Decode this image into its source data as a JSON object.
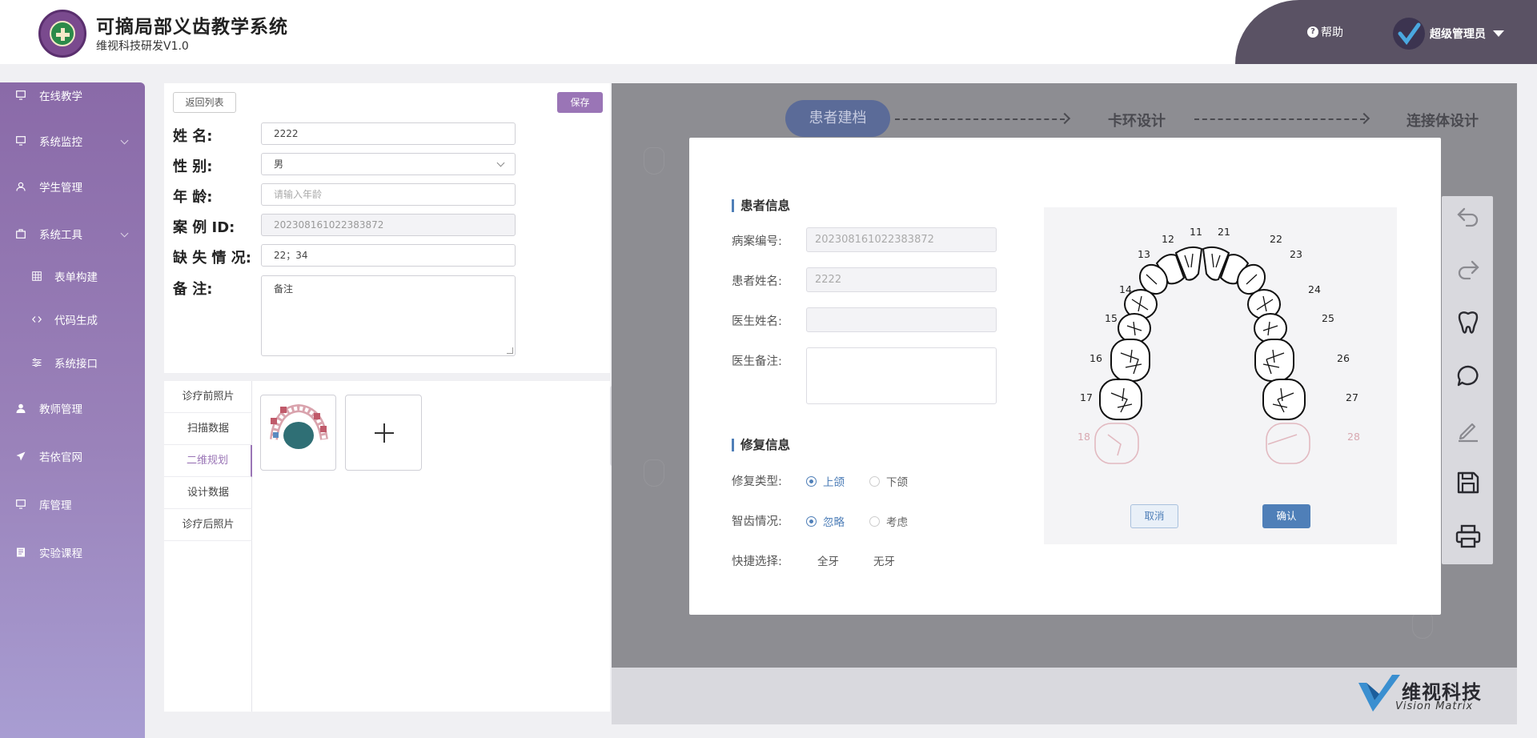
{
  "header": {
    "app_title": "可摘局部义齿教学系统",
    "app_subtitle": "维视科技研发V1.0",
    "help_label": "帮助",
    "user_name": "超级管理员"
  },
  "sidebar": {
    "items": [
      {
        "label": "在线教学",
        "icon": "monitor-icon"
      },
      {
        "label": "系统监控",
        "icon": "monitor-icon"
      },
      {
        "label": "学生管理",
        "icon": "user-icon"
      },
      {
        "label": "系统工具",
        "icon": "toolbox-icon"
      },
      {
        "label": "表单构建",
        "icon": "grid-icon"
      },
      {
        "label": "代码生成",
        "icon": "code-icon"
      },
      {
        "label": "系统接口",
        "icon": "sliders-icon"
      },
      {
        "label": "教师管理",
        "icon": "user-icon"
      },
      {
        "label": "若依官网",
        "icon": "send-icon"
      },
      {
        "label": "库管理",
        "icon": "monitor-icon"
      },
      {
        "label": "实验课程",
        "icon": "book-icon"
      }
    ]
  },
  "form": {
    "back_label": "返回列表",
    "save_label": "保存",
    "name_label": "姓 名:",
    "name_value": "2222",
    "gender_label": "性 别:",
    "gender_value": "男",
    "age_label": "年 龄:",
    "age_placeholder": "请输入年龄",
    "case_id_label": "案 例 ID:",
    "case_id_value": "202308161022383872",
    "missing_label": "缺 失 情 况:",
    "missing_value": "22；34",
    "note_label": "备 注:",
    "note_value": "备注"
  },
  "tabs": [
    {
      "label": "诊疗前照片",
      "active": false
    },
    {
      "label": "扫描数据",
      "active": false
    },
    {
      "label": "二维规划",
      "active": true
    },
    {
      "label": "设计数据",
      "active": false
    },
    {
      "label": "诊疗后照片",
      "active": false
    }
  ],
  "steps": {
    "step1": "患者建档",
    "step2": "卡环设计",
    "step3": "连接体设计"
  },
  "dialog": {
    "patient_section": "患者信息",
    "record_no_label": "病案编号:",
    "record_no_value": "202308161022383872",
    "patient_name_label": "患者姓名:",
    "patient_name_value": "2222",
    "doctor_name_label": "医生姓名:",
    "doctor_note_label": "医生备注:",
    "repair_section": "修复信息",
    "repair_type_label": "修复类型:",
    "repair_type_options": [
      "上颌",
      "下颌"
    ],
    "repair_type_selected": "上颌",
    "wisdom_label": "智齿情况:",
    "wisdom_options": [
      "忽略",
      "考虑"
    ],
    "wisdom_selected": "忽略",
    "quick_label": "快捷选择:",
    "quick_options": [
      "全牙",
      "无牙"
    ],
    "cancel_label": "取消",
    "confirm_label": "确认"
  },
  "teeth": {
    "right_side": [
      "11",
      "12",
      "13",
      "14",
      "15",
      "16",
      "17",
      "18"
    ],
    "left_side": [
      "21",
      "22",
      "23",
      "24",
      "25",
      "26",
      "27",
      "28"
    ],
    "disabled": [
      "18",
      "28"
    ]
  },
  "brand": {
    "cn": "维视科技",
    "en": "Vision Matrix"
  },
  "colors": {
    "sidebar_top": "#8a6aa8",
    "sidebar_bottom": "#a89dd2",
    "accent_purple": "#9a75b6",
    "accent_blue": "#4f7fb8",
    "header_dark": "#5a5264"
  }
}
